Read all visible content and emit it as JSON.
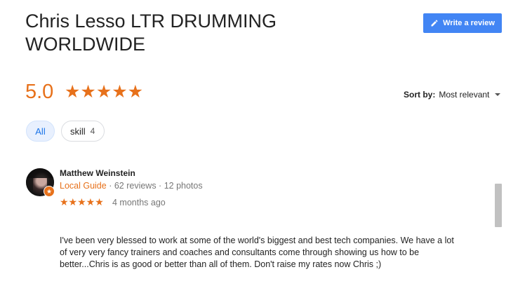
{
  "place": {
    "title_line1": "Chris Lesso LTR DRUMMING",
    "title_line2": "WORLDWIDE"
  },
  "write_review": {
    "label": "Write a review",
    "icon": "pencil-icon"
  },
  "rating": {
    "value": "5.0",
    "stars": "★★★★★",
    "star_count": 5
  },
  "sort": {
    "label": "Sort by:",
    "value": "Most relevant"
  },
  "filters": [
    {
      "label": "All",
      "count": "",
      "selected": true
    },
    {
      "label": "skill",
      "count": "4",
      "selected": false
    }
  ],
  "review": {
    "author": "Matthew Weinstein",
    "badge": "Local Guide",
    "reviews_count": "62 reviews",
    "photos_count": "12 photos",
    "separator": " · ",
    "stars": "★★★★★",
    "star_count": 5,
    "time": "4 months ago",
    "text": "I've been very blessed to work at some of the world's biggest and best tech companies.  We have a lot\nof very very fancy trainers and coaches and consultants come through showing us how to be\nbetter...Chris is as good or better than all of them.  Don't raise my rates now Chris ;)"
  },
  "colors": {
    "accent_orange": "#e7711b",
    "button_blue": "#4285f4",
    "chip_selected_text": "#1a73e8"
  }
}
